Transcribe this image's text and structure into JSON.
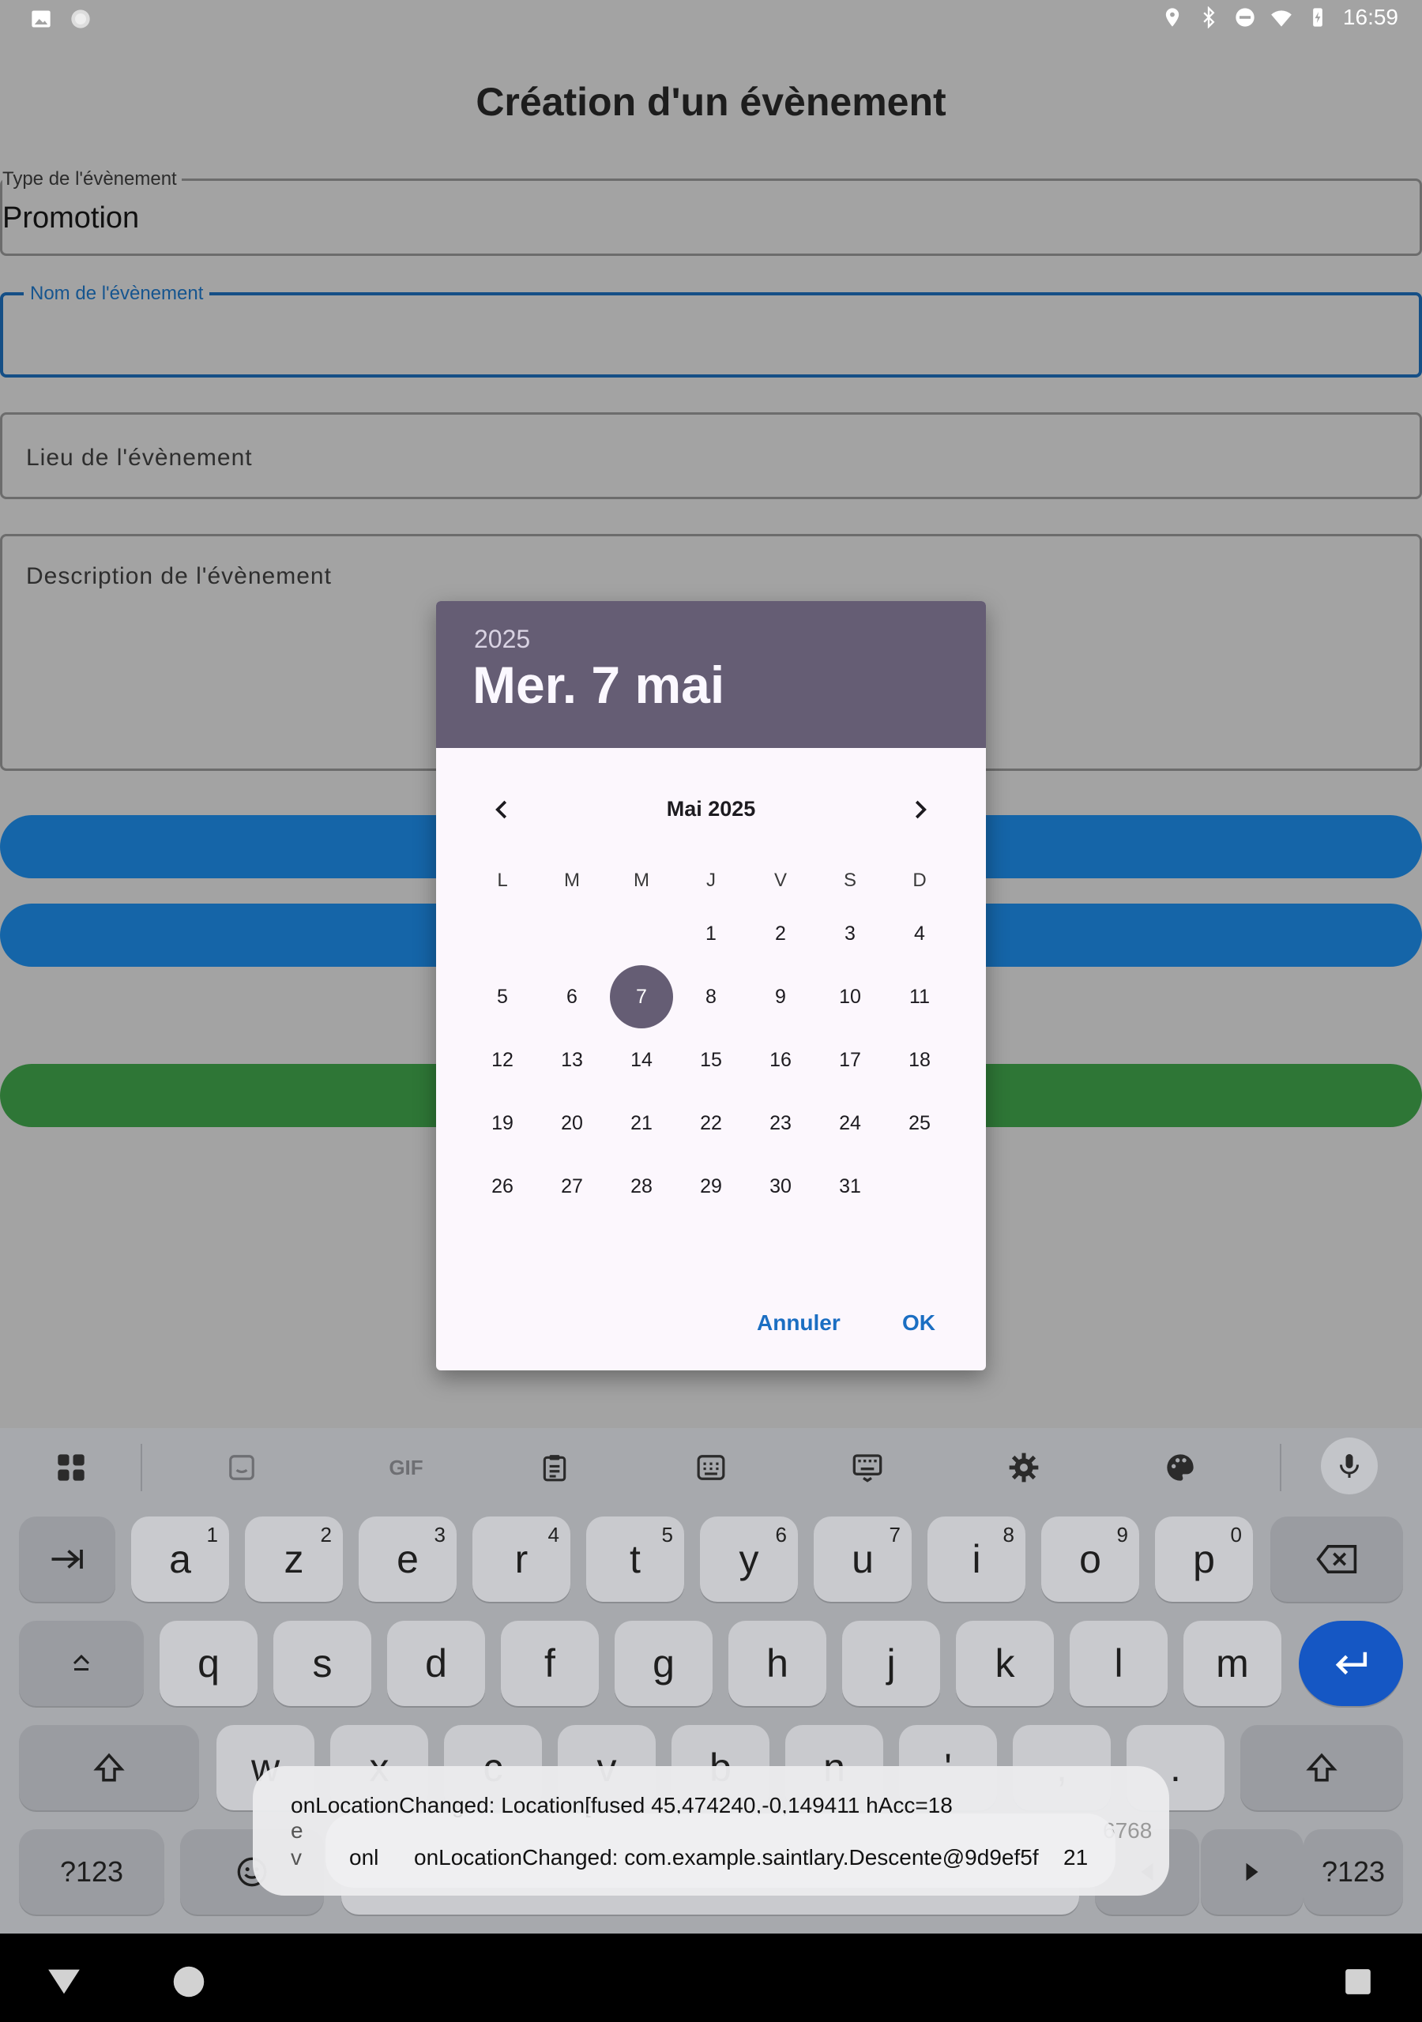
{
  "status_bar": {
    "time": "16:59",
    "left_icons": [
      "image-icon",
      "circle-icon"
    ],
    "right_icons": [
      "location-icon",
      "bluetooth-icon",
      "dnd-icon",
      "wifi-icon",
      "battery-icon"
    ]
  },
  "page": {
    "title": "Création d'un évènement",
    "fields": {
      "type_label": "Type de l'évènement",
      "type_value": "Promotion",
      "name_label": "Nom de l'évènement",
      "place_placeholder": "Lieu de l'évènement",
      "description_placeholder": "Description de l'évènement"
    },
    "colors": {
      "primary_button": "#1565a8",
      "success_button": "#2e7636"
    }
  },
  "date_picker": {
    "year": "2025",
    "selected_date": "Mer. 7 mai",
    "month_label": "Mai 2025",
    "weekdays": [
      "L",
      "M",
      "M",
      "J",
      "V",
      "S",
      "D"
    ],
    "days": [
      [
        "",
        "",
        "",
        "1",
        "2",
        "3",
        "4"
      ],
      [
        "5",
        "6",
        "7",
        "8",
        "9",
        "10",
        "11"
      ],
      [
        "12",
        "13",
        "14",
        "15",
        "16",
        "17",
        "18"
      ],
      [
        "19",
        "20",
        "21",
        "22",
        "23",
        "24",
        "25"
      ],
      [
        "26",
        "27",
        "28",
        "29",
        "30",
        "31",
        ""
      ]
    ],
    "selected_day": "7",
    "cancel_label": "Annuler",
    "ok_label": "OK",
    "header_color": "#655d74"
  },
  "keyboard": {
    "toolbar_icons": [
      "apps-grid-icon",
      "sticker-icon",
      "gif-icon",
      "clipboard-icon",
      "keyboard-layout-icon",
      "keyboard-icon",
      "settings-gear-icon",
      "palette-icon",
      "microphone-icon"
    ],
    "gif_label": "GIF",
    "row1": [
      {
        "k": "a",
        "h": "1"
      },
      {
        "k": "z",
        "h": "2"
      },
      {
        "k": "e",
        "h": "3"
      },
      {
        "k": "r",
        "h": "4"
      },
      {
        "k": "t",
        "h": "5"
      },
      {
        "k": "y",
        "h": "6"
      },
      {
        "k": "u",
        "h": "7"
      },
      {
        "k": "i",
        "h": "8"
      },
      {
        "k": "o",
        "h": "9"
      },
      {
        "k": "p",
        "h": "0"
      }
    ],
    "row2": [
      "q",
      "s",
      "d",
      "f",
      "g",
      "h",
      "j",
      "k",
      "l",
      "m"
    ],
    "row3": [
      "w",
      "x",
      "c",
      "v",
      "b",
      "n",
      "'",
      ",",
      "."
    ],
    "symbols_label": "?123"
  },
  "toast": {
    "line1": "onLocationChanged: Location[fused 45,474240,-0,149411 hAcc=18",
    "line2_fragment": "e",
    "line2_right": "6768",
    "line3_prefix": "v",
    "line3_right": "21",
    "overlay_prefix": "onl",
    "overlay_text": "onLocationChanged: com.example.saintlary.Descente@9d9ef5f"
  }
}
